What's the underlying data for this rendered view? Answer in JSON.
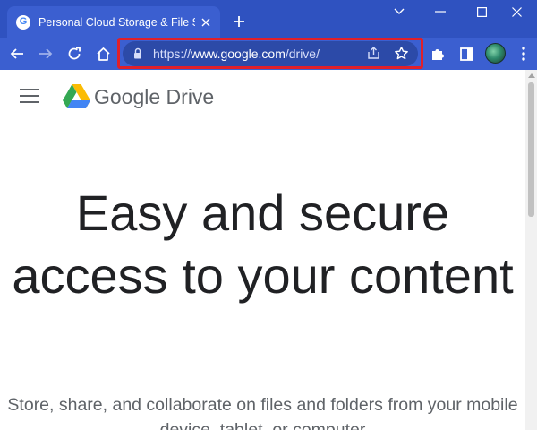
{
  "browser": {
    "tab": {
      "title": "Personal Cloud Storage & File Sh",
      "favicon_letter": "G",
      "close_icon": "close-icon"
    },
    "new_tab_icon": "plus-icon",
    "window_controls": [
      "chevron-down-icon",
      "minimize-icon",
      "maximize-icon",
      "close-icon"
    ],
    "toolbar": {
      "back_icon": "arrow-left-icon",
      "forward_icon": "arrow-right-icon",
      "reload_icon": "reload-icon",
      "home_icon": "home-icon",
      "extensions_icon": "puzzle-icon",
      "sidepanel_icon": "side-panel-icon",
      "menu_icon": "kebab-menu-icon"
    },
    "omnibox": {
      "url_prefix": "https://",
      "url_host": "www.google.com",
      "url_path": "/drive/",
      "share_icon": "share-icon",
      "bookmark_icon": "star-icon"
    },
    "colors": {
      "chrome_bg": "#2f52c0",
      "tab_bg": "#3b5fd0",
      "highlight": "#e0202a"
    }
  },
  "page": {
    "brand_name": "Google Drive",
    "hero_title": "Easy and secure access to your content",
    "hero_subtitle": "Store, share, and collaborate on files and folders from your mobile device, tablet, or computer"
  }
}
